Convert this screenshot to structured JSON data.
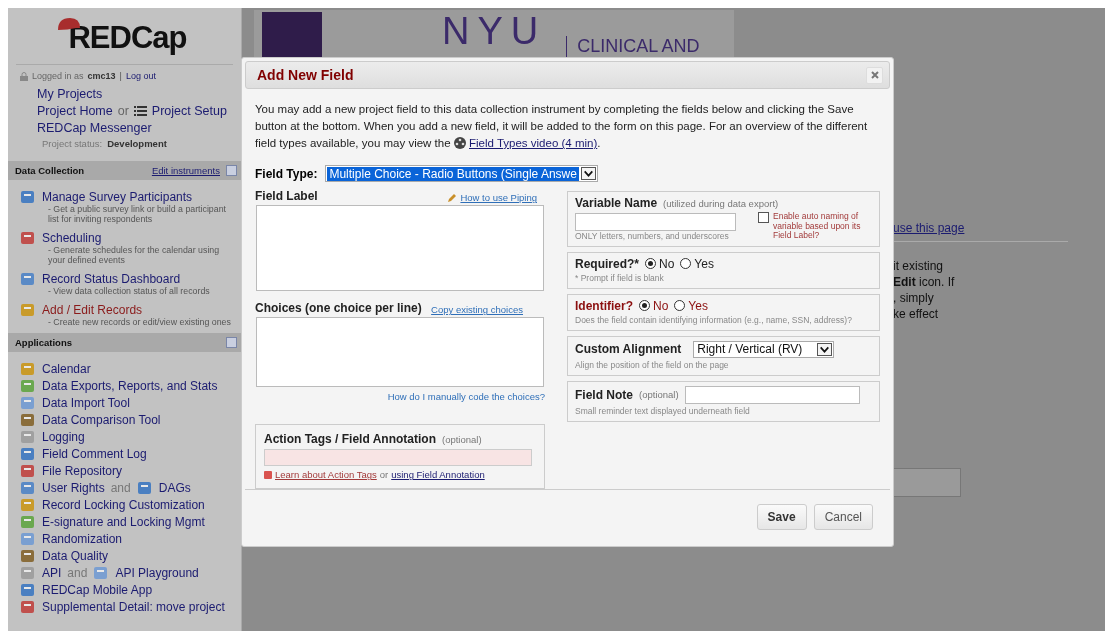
{
  "sidebar": {
    "logo": "REDCap",
    "login_prefix": "Logged in as",
    "user": "cmc13",
    "separator": "|",
    "logout": "Log out",
    "links": [
      {
        "label": "My Projects"
      },
      {
        "label": "Project Home",
        "connector": "or",
        "extra_label": "Project Setup"
      },
      {
        "label": "REDCap Messenger"
      }
    ],
    "status_label": "Project status:",
    "status": "Development",
    "sections": [
      {
        "title": "Data Collection",
        "action": "Edit instruments",
        "items": [
          {
            "label": "Manage Survey Participants",
            "description": "- Get a public survey link or build a participant list for inviting respondents",
            "selected": false
          },
          {
            "label": "Scheduling",
            "description": "- Generate schedules for the calendar using your defined events",
            "selected": false
          },
          {
            "label": "Record Status Dashboard",
            "description": "- View data collection status of all records",
            "selected": false
          },
          {
            "label": "Add / Edit Records",
            "description": "- Create new records or edit/view existing ones",
            "selected": true
          }
        ]
      },
      {
        "title": "Applications",
        "items": [
          {
            "label": "Calendar"
          },
          {
            "label": "Data Exports, Reports, and Stats"
          },
          {
            "label": "Data Import Tool"
          },
          {
            "label": "Data Comparison Tool"
          },
          {
            "label": "Logging"
          },
          {
            "label": "Field Comment Log"
          },
          {
            "label": "File Repository"
          },
          {
            "label": "User Rights",
            "connector": "and",
            "extra_label": "DAGs"
          },
          {
            "label": "Record Locking Customization"
          },
          {
            "label": "E-signature and Locking Mgmt"
          },
          {
            "label": "Randomization"
          },
          {
            "label": "Data Quality"
          },
          {
            "label": "API",
            "connector": "and",
            "extra_label": "API Playground"
          },
          {
            "label": "REDCap Mobile App"
          },
          {
            "label": "Supplemental Detail: move project"
          }
        ]
      }
    ]
  },
  "banner": {
    "logo_text": "NYU",
    "subtitle": "CLINICAL AND"
  },
  "background": {
    "link": "use this page",
    "fragments": [
      "it existing",
      "**Edit** icon. If",
      ", simply",
      "ke effect"
    ]
  },
  "dialog": {
    "title": "Add New Field",
    "intro": "You may add a new project field to this data collection instrument by completing the fields below and clicking the Save button at the bottom. When you add a new field, it will be added to the form on this page. For an overview of the different field types available, you may view the",
    "video_link": "Field Types video (4 min)",
    "intro_end": ".",
    "field_type": {
      "label": "Field Type:",
      "value": "Multiple Choice - Radio Buttons (Single Answe"
    },
    "field_label": {
      "label": "Field Label",
      "link": "How to use Piping"
    },
    "choices": {
      "label": "Choices (one choice per line)",
      "link": "Copy existing choices",
      "help_link": "How do I manually code the choices?"
    },
    "action_tags": {
      "label": "Action Tags / Field Annotation",
      "optional": "(optional)",
      "link": "Learn about Action Tags",
      "connector": "or",
      "link2": "using Field Annotation"
    },
    "variable_name": {
      "label": "Variable Name",
      "note": "(utilized during data export)",
      "hint": "ONLY letters, numbers, and underscores",
      "auto_label": "Enable auto naming of variable based upon its Field Label?",
      "auto_checked": false
    },
    "required": {
      "label": "Required?*",
      "options": [
        {
          "label": "No",
          "selected": true
        },
        {
          "label": "Yes",
          "selected": false
        }
      ],
      "hint": "* Prompt if field is blank"
    },
    "identifier": {
      "label": "Identifier?",
      "options": [
        {
          "label": "No",
          "selected": true
        },
        {
          "label": "Yes",
          "selected": false
        }
      ],
      "hint": "Does the field contain identifying information (e.g., name, SSN, address)?"
    },
    "alignment": {
      "label": "Custom Alignment",
      "value": "Right / Vertical (RV)",
      "hint": "Align the position of the field on the page"
    },
    "field_note": {
      "label": "Field Note",
      "optional": "(optional)",
      "hint": "Small reminder text displayed underneath field"
    },
    "buttons": [
      {
        "label": "Save",
        "kind": "primary"
      },
      {
        "label": "Cancel",
        "kind": "secondary"
      }
    ]
  }
}
